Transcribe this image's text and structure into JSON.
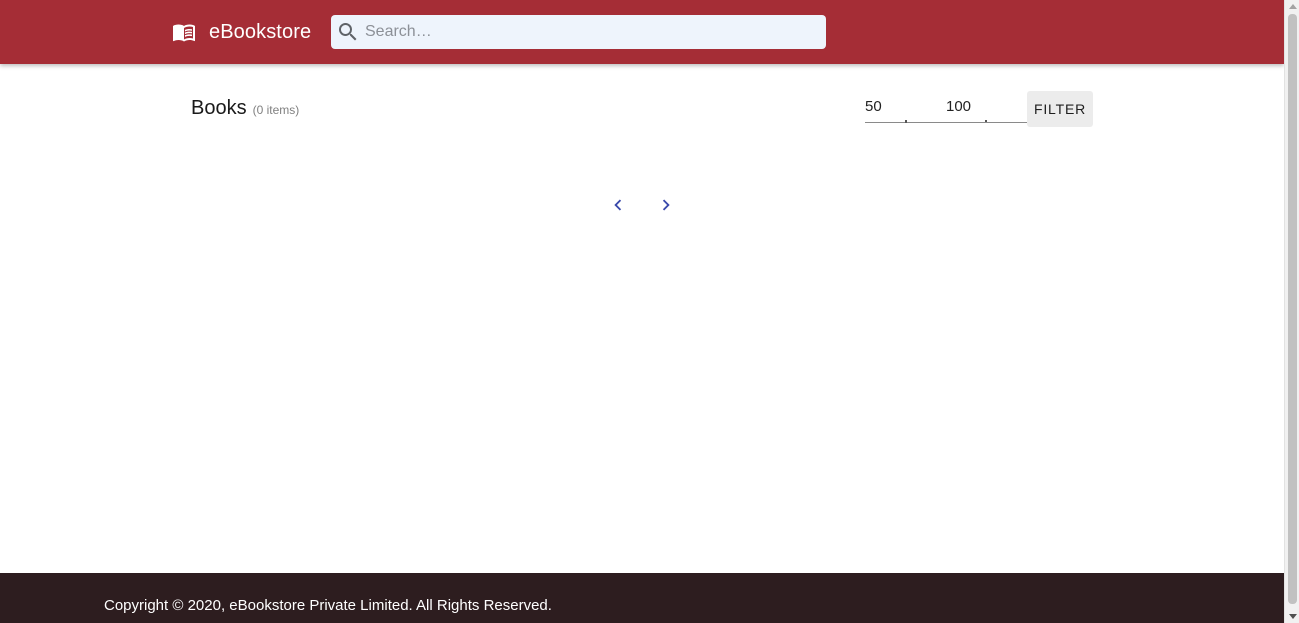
{
  "header": {
    "brand_title": "eBookstore",
    "brand_icon": "book-open-icon",
    "search_placeholder": "Search…",
    "search_icon": "search-icon",
    "background_color": "#a52d36"
  },
  "main": {
    "title": "Books",
    "item_count": "(0 items)",
    "price_range": {
      "min": "50",
      "max": "100"
    },
    "filter_label": "FILTER",
    "pagination": {
      "prev_icon": "chevron-left-icon",
      "next_icon": "chevron-right-icon",
      "accent_color": "#3949ab"
    }
  },
  "footer": {
    "copyright": "Copyright © 2020, eBookstore Private Limited. All Rights Reserved.",
    "background_color": "#2d1d1f"
  }
}
